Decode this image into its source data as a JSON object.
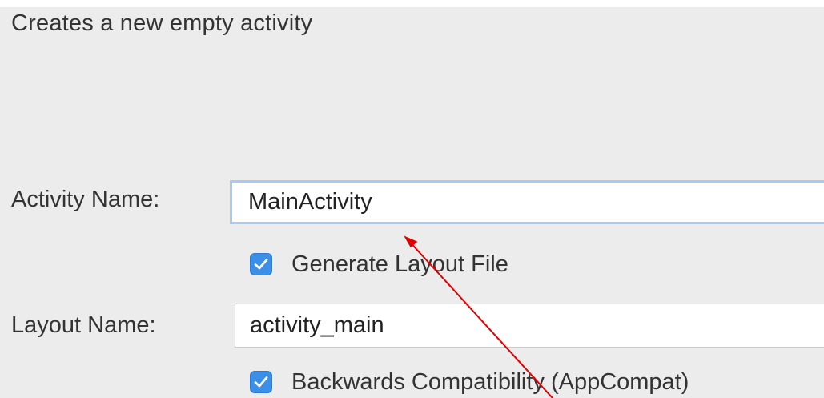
{
  "description": "Creates a new empty activity",
  "activity": {
    "label": "Activity Name:",
    "value": "MainActivity"
  },
  "generate_layout": {
    "label": "Generate Layout File",
    "checked": true
  },
  "layout": {
    "label": "Layout Name:",
    "value": "activity_main"
  },
  "backwards_compat": {
    "label": "Backwards Compatibility (AppCompat)",
    "checked": true
  },
  "colors": {
    "panel_background": "#ececec",
    "checkbox_accent": "#3b8fe6",
    "focus_ring": "#a9c8f2",
    "annotation_arrow": "#e00000"
  },
  "icons": {
    "checkbox_check": "checkmark-icon",
    "annotation": "red-arrow-icon"
  }
}
